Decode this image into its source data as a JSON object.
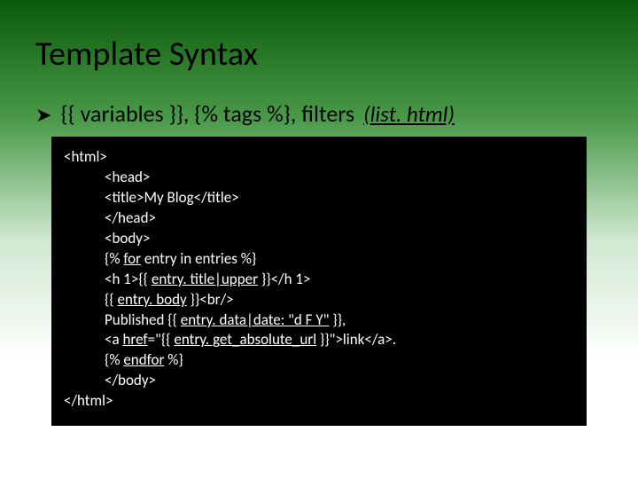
{
  "title": "Template Syntax",
  "bullet": {
    "arrow": "➤",
    "text": "{{ variables }}, {% tags %}, filters",
    "filename": "(list. html)"
  },
  "code": {
    "l0": "<html>",
    "l1": "<head>",
    "l2": "<title>My Blog</title>",
    "l3": "</head>",
    "l4": "<body>",
    "l5a": "{% ",
    "l5b": "for",
    "l5c": " entry in entries %}",
    "l6a": "<h 1>{{ ",
    "l6b": "entry. title|upper",
    "l6c": " }}</h 1>",
    "l7a": "{{ ",
    "l7b": "entry. body",
    "l7c": " }}<br/>",
    "l8a": "Published {{ ",
    "l8b": "entry. data|date: \"d F Y\"",
    "l8c": " }},",
    "l9a": "<a ",
    "l9b": "href",
    "l9c": "=\"{{ ",
    "l9d": "entry. get_absolute_url",
    "l9e": " }}\">link</a>.",
    "l10a": "{% ",
    "l10b": "endfor",
    "l10c": " %}",
    "l11": "</body>",
    "l12": "</html>"
  }
}
